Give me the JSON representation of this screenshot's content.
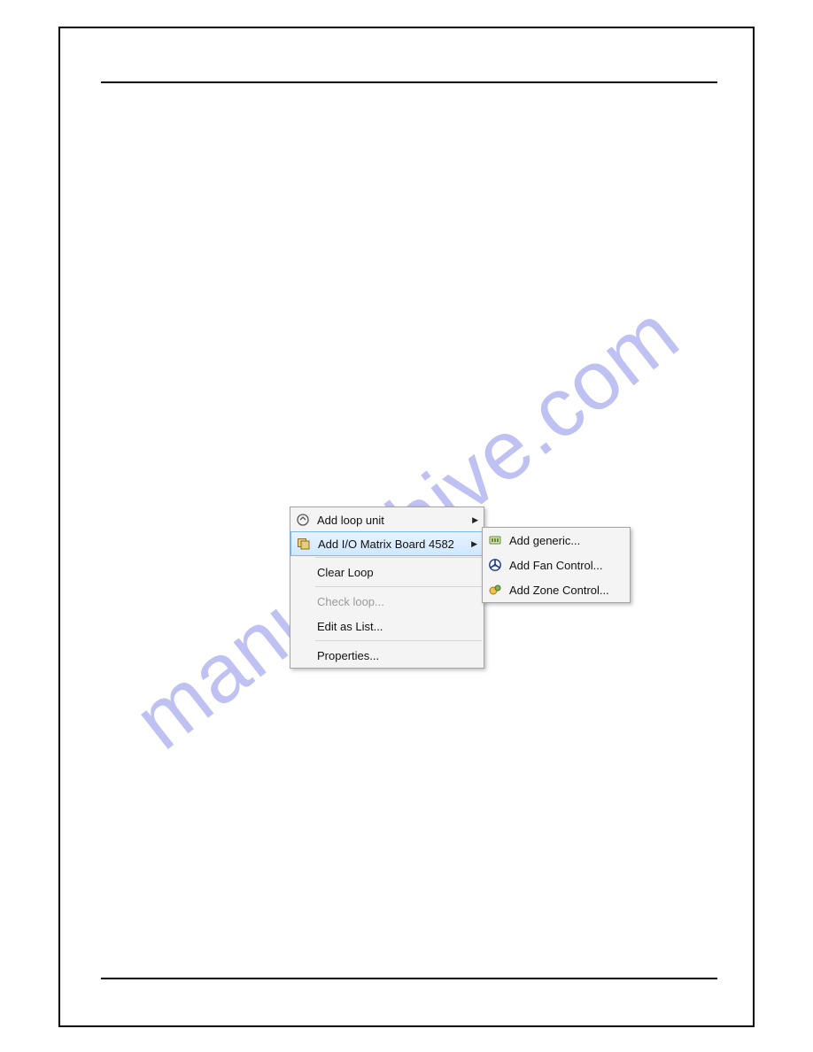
{
  "watermark": "manualshive.com",
  "menu": {
    "items": [
      {
        "label": "Add loop unit",
        "has_sub": true,
        "enabled": true,
        "icon": "loop-icon"
      },
      {
        "label": "Add I/O Matrix Board 4582",
        "has_sub": true,
        "enabled": true,
        "icon": "matrix-icon",
        "selected": true
      },
      {
        "label": "Clear Loop",
        "has_sub": false,
        "enabled": true
      },
      {
        "label": "Check loop...",
        "has_sub": false,
        "enabled": false
      },
      {
        "label": "Edit as List...",
        "has_sub": false,
        "enabled": true
      },
      {
        "label": "Properties...",
        "has_sub": false,
        "enabled": true
      }
    ]
  },
  "submenu": {
    "items": [
      {
        "label": "Add generic...",
        "icon": "generic-icon"
      },
      {
        "label": "Add Fan Control...",
        "icon": "fan-icon"
      },
      {
        "label": "Add Zone Control...",
        "icon": "zone-icon"
      }
    ]
  }
}
